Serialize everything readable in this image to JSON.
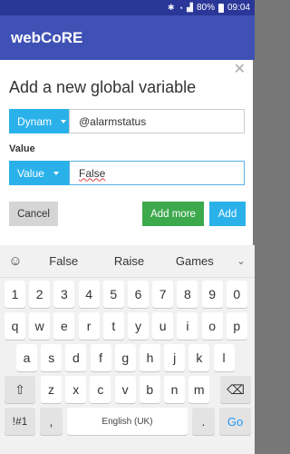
{
  "status_bar": {
    "battery": "80%",
    "time": "09:04",
    "icons": [
      "bluetooth-icon",
      "wifi-icon",
      "signal-icon",
      "battery-icon"
    ]
  },
  "app_bar": {
    "title": "webCoRE"
  },
  "dialog": {
    "title": "Add a new global variable",
    "name_type_label": "Dynam",
    "name_value": "@alarmstatus",
    "value_section_label": "Value",
    "value_type_label": "Value",
    "value_text": "False",
    "cancel_label": "Cancel",
    "add_more_label": "Add more",
    "add_label": "Add"
  },
  "keyboard": {
    "suggestions": [
      "False",
      "Raise",
      "Games"
    ],
    "row_numbers": [
      "1",
      "2",
      "3",
      "4",
      "5",
      "6",
      "7",
      "8",
      "9",
      "0"
    ],
    "row_q": [
      "q",
      "w",
      "e",
      "r",
      "t",
      "y",
      "u",
      "i",
      "o",
      "p"
    ],
    "row_a": [
      "a",
      "s",
      "d",
      "f",
      "g",
      "h",
      "j",
      "k",
      "l"
    ],
    "row_z": [
      "z",
      "x",
      "c",
      "v",
      "b",
      "n",
      "m"
    ],
    "symbols_label": "!#1",
    "comma_label": ",",
    "space_label": "English (UK)",
    "period_label": ".",
    "go_label": "Go"
  },
  "colors": {
    "status_bar": "#2b3798",
    "app_bar": "#3f51b5",
    "primary_button": "#2ab1ea",
    "success_button": "#3ca94d"
  }
}
